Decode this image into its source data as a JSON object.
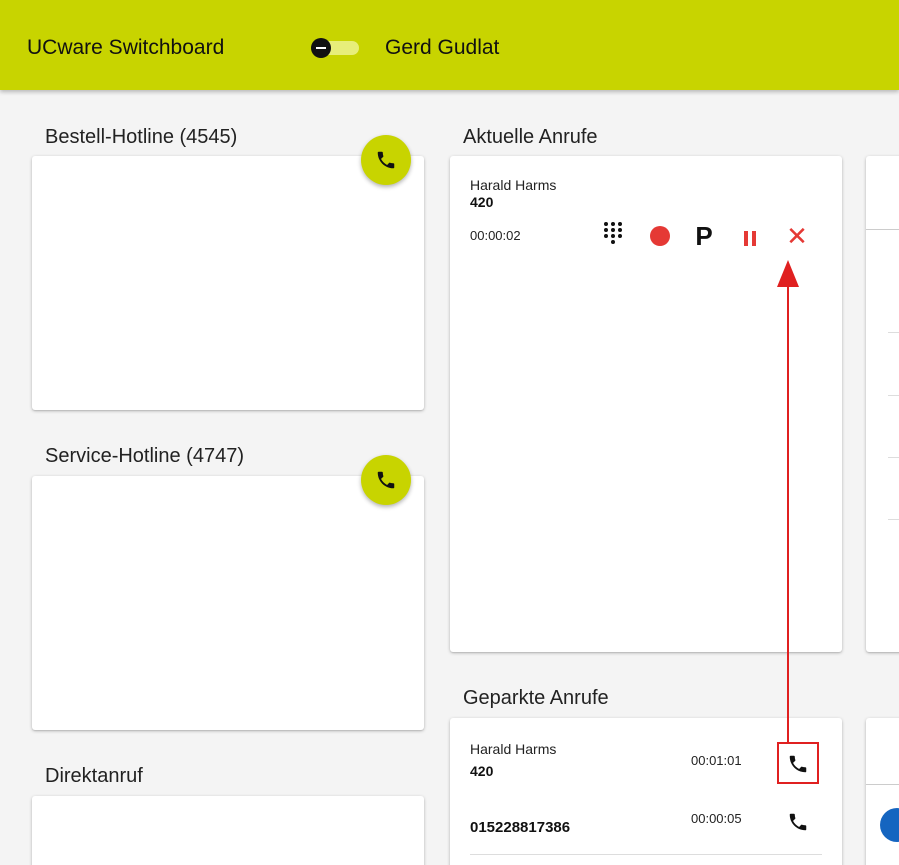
{
  "header": {
    "app_title": "UCware Switchboard",
    "user_name": "Gerd Gudlat",
    "toggle_state": "off"
  },
  "queues": [
    {
      "title": "Bestell-Hotline (4545)"
    },
    {
      "title": "Service-Hotline (4747)"
    }
  ],
  "direct_call": {
    "title": "Direktanruf"
  },
  "current_calls": {
    "title": "Aktuelle Anrufe",
    "call": {
      "name": "Harald Harms",
      "number": "420",
      "duration": "00:00:02"
    },
    "actions": [
      "dialpad-icon",
      "record-icon",
      "park-icon",
      "hold-icon",
      "hangup-icon"
    ]
  },
  "parked_calls": {
    "title": "Geparkte Anrufe",
    "items": [
      {
        "name": "Harald Harms",
        "number": "420",
        "duration": "00:01:01"
      },
      {
        "name": "",
        "number": "015228817386",
        "duration": "00:00:05"
      }
    ]
  },
  "colors": {
    "accent": "#c8d400",
    "danger": "#e53935",
    "annotation": "#e02020"
  }
}
